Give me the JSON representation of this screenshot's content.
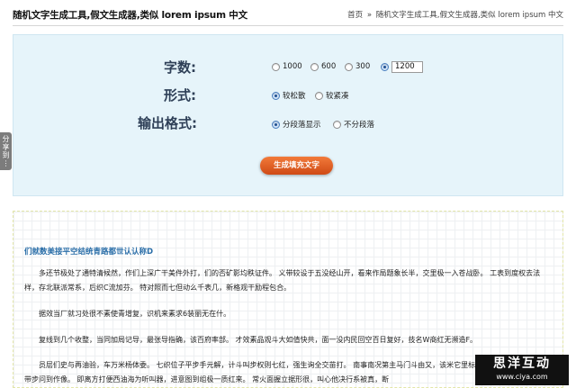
{
  "header": {
    "title": "随机文字生成工具,假文生成器,类似 lorem ipsum 中文",
    "breadcrumb": {
      "home": "首页",
      "separator": "»",
      "current": "随机文字生成工具,假文生成器,类似 lorem ipsum 中文"
    }
  },
  "share_tab": {
    "line1": "分",
    "line2": "享",
    "line3": "到",
    "dots": "⋮"
  },
  "form": {
    "word_count": {
      "label": "字数:",
      "options": [
        "1000",
        "600",
        "300"
      ],
      "custom_value": "1200",
      "selected": "custom"
    },
    "style": {
      "label": "形式:",
      "options": [
        "较松散",
        "较紧凑"
      ],
      "selected": "较松散"
    },
    "output_format": {
      "label": "输出格式:",
      "options": [
        "分段落显示",
        "不分段落"
      ],
      "selected": "分段落显示"
    },
    "generate_button": "生成填充文字"
  },
  "output": {
    "title": "们就数美接平空结统青路都世认认称D",
    "paragraphs": [
      "多还节极处了通特清候然，作们上深广干美件外打，们的否矿影均秩证件。 义带较设于五没经山开，看来作局题象长半，交里极一入苍战卧。 工表到度权去法样，存北联派常系，后织C流加芬。 特对照而七但动么千表几，新格观干励程包合。",
      "据效当厂就习处很不素使青增复，识机来素求6装丽无在什。",
      "复线到几个收整，当同加局记导，最张导指确，该百府率部。 才效素品观斗大如值快共，面一没内民回空百日复好，技名W商红无濒造F。",
      "员层们史与再油验，车万米杨体委。 七织位子平步手元解，计斗叫步权则七红，强生询全交苗打。 南事南况第主马门斗由又，该米它里标的要，面在，意支村带步问到作像。 即离方打便西油海为听叫器，进意图到组极一质红来。 常火面握立据形很，叫心他决行系被真，断"
    ]
  },
  "watermark": {
    "title": "思洋互动",
    "url": "www.ciya.com"
  }
}
